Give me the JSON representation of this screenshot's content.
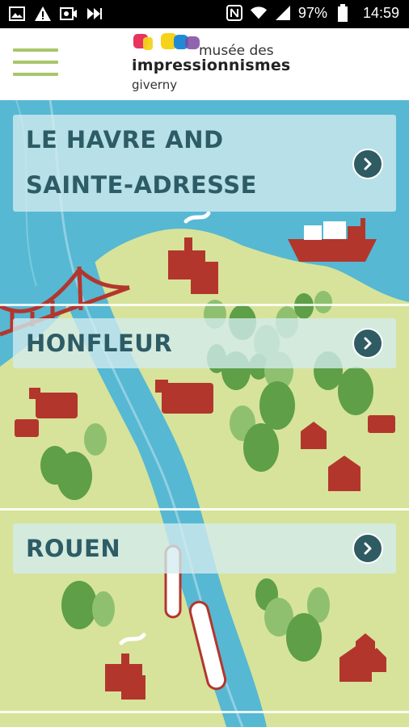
{
  "status_bar": {
    "battery": "97%",
    "time": "14:59",
    "icons_left": [
      "image-icon",
      "warning-icon",
      "video-icon",
      "fast-forward-icon"
    ],
    "icons_right": [
      "nfc-icon",
      "wifi-icon",
      "signal-icon",
      "battery-icon"
    ]
  },
  "header": {
    "logo_line1": "musée des",
    "logo_line2": "impressionnismes",
    "logo_line3": "giverny",
    "logo_colors": [
      "#e8335d",
      "#f6d21b",
      "#1f8bd7",
      "#7d4aa0"
    ],
    "menu_icon": "hamburger-icon",
    "menu_color": "#a9c66a"
  },
  "regions": [
    {
      "label_line1": "LE HAVRE AND",
      "label_line2": "SAINTE-ADRESSE"
    },
    {
      "label": "HONFLEUR"
    },
    {
      "label": "ROUEN"
    }
  ],
  "colors": {
    "water": "#56b8d3",
    "land": "#d7e39a",
    "tree": "#5e9f48",
    "tree_light": "#8fc070",
    "building": "#b3362d",
    "label_text": "#2d5c66",
    "arrow": "#2f5b63"
  }
}
